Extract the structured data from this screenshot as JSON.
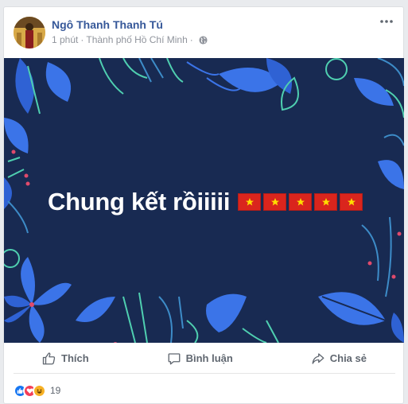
{
  "post": {
    "author": "Ngô Thanh Thanh Tú",
    "time": "1 phút",
    "separator": "·",
    "location": "Thành phố Hồ Chí Minh",
    "privacy_icon": "globe-icon"
  },
  "banner": {
    "text": "Chung kết rồiiiii",
    "flag_count": 5,
    "colors": {
      "background": "#182a52",
      "flag": "#da251d",
      "star": "#ffde00",
      "leaf": "#3b74e8",
      "accent": "#4fcfb0"
    }
  },
  "actions": {
    "like": "Thích",
    "comment": "Bình luận",
    "share": "Chia sẻ"
  },
  "reactions": {
    "icons": [
      "like-icon",
      "love-icon",
      "haha-icon"
    ],
    "count": "19"
  }
}
